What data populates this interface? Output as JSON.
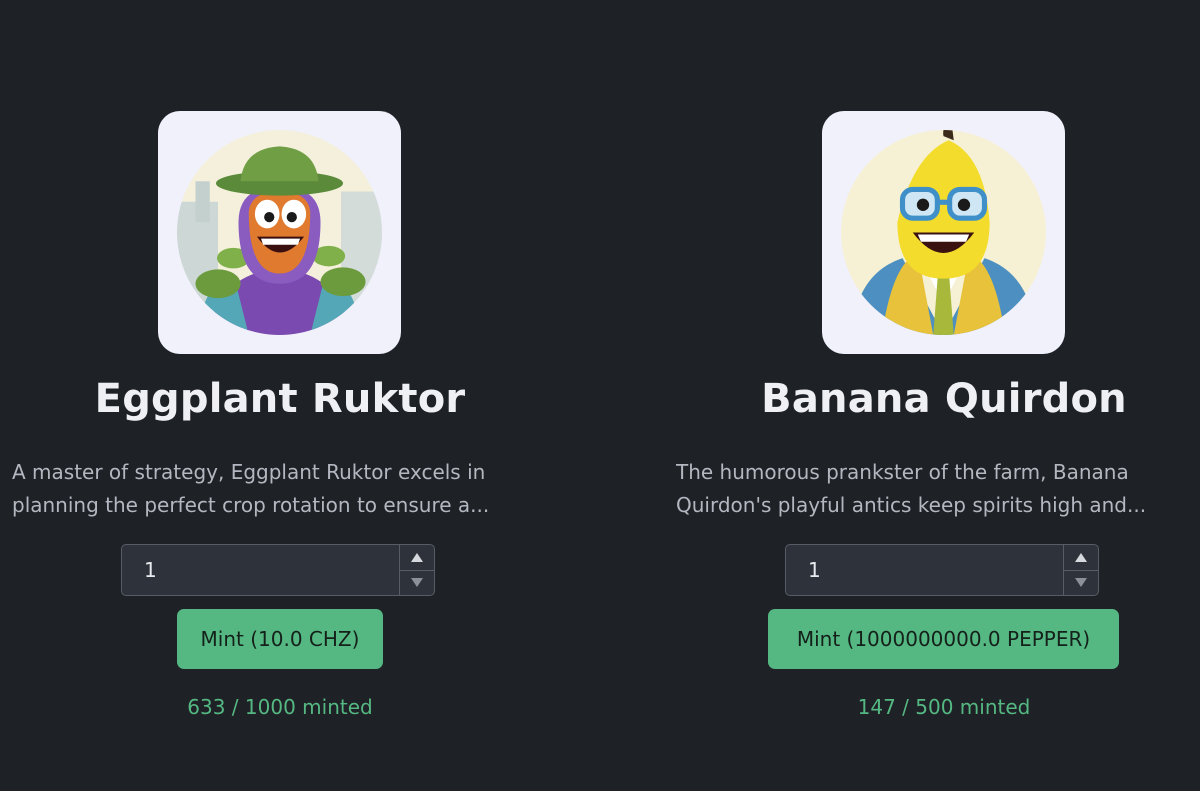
{
  "cards": [
    {
      "name": "Eggplant Ruktor",
      "description_line1": "A master of strategy, Eggplant Ruktor excels in",
      "description_line2": "planning the perfect crop rotation to ensure a...",
      "quantity": "1",
      "mint_label": "Mint (10.0 CHZ)",
      "minted": "633 / 1000 minted",
      "avatar_icon": "eggplant-character-icon"
    },
    {
      "name": "Banana Quirdon",
      "description_line1": "The humorous prankster of the farm, Banana",
      "description_line2": "Quirdon's playful antics keep spirits high and...",
      "quantity": "1",
      "mint_label": "Mint (1000000000.0 PEPPER)",
      "minted": "147 / 500 minted",
      "avatar_icon": "banana-character-icon"
    }
  ],
  "colors": {
    "background": "#1e2126",
    "accent": "#55b882",
    "title": "#eef0f3",
    "description": "#b3b8c0",
    "tile": "#f1f1fb"
  }
}
